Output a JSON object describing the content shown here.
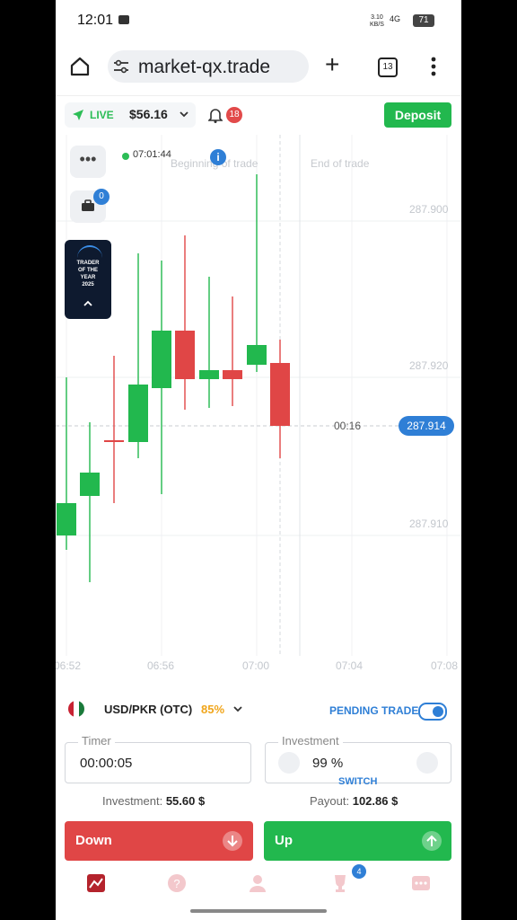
{
  "status_bar": {
    "time": "12:01",
    "net_speed": "3.10\nKB/S",
    "signal": "4G",
    "battery": "71"
  },
  "browser": {
    "url": "market-qx.trade",
    "tab_count": "13"
  },
  "account": {
    "mode": "LIVE",
    "balance": "$56.16",
    "notifications": "18",
    "deposit_label": "Deposit"
  },
  "chart": {
    "clock": "07:01:44",
    "begin_label": "Beginning of trade",
    "end_label": "End of trade",
    "countdown": "00:16",
    "current_price": "287.914",
    "trades_badge": "0",
    "promo_text": "TRADER\nOF THE\nYEAR\n2025",
    "colors": {
      "up": "#22b84e",
      "down": "#e04646",
      "accent": "#2f7fd6"
    }
  },
  "chart_data": {
    "type": "candlestick",
    "y_ticks": [
      "287.900",
      "287.920",
      "287.910"
    ],
    "x_ticks": [
      "06:52",
      "06:56",
      "07:00",
      "07:04",
      "07:08"
    ],
    "current_price": 287.914,
    "candles": [
      {
        "dir": "up"
      },
      {
        "dir": "up"
      },
      {
        "dir": "down"
      },
      {
        "dir": "up"
      },
      {
        "dir": "up"
      },
      {
        "dir": "down"
      },
      {
        "dir": "up"
      },
      {
        "dir": "down"
      },
      {
        "dir": "up"
      },
      {
        "dir": "down"
      }
    ]
  },
  "trade": {
    "asset": "USD/PKR (OTC)",
    "payout_pct": "85%",
    "pending_label": "PENDING TRADE",
    "timer_label": "Timer",
    "timer_value": "00:00:05",
    "investment_label": "Investment",
    "investment_value": "99 %",
    "switch_label": "SWITCH",
    "investment_summary_label": "Investment:",
    "investment_summary_value": "55.60 $",
    "payout_summary_label": "Payout:",
    "payout_summary_value": "102.86 $",
    "down_label": "Down",
    "up_label": "Up"
  },
  "nav": {
    "tournaments_badge": "4"
  }
}
